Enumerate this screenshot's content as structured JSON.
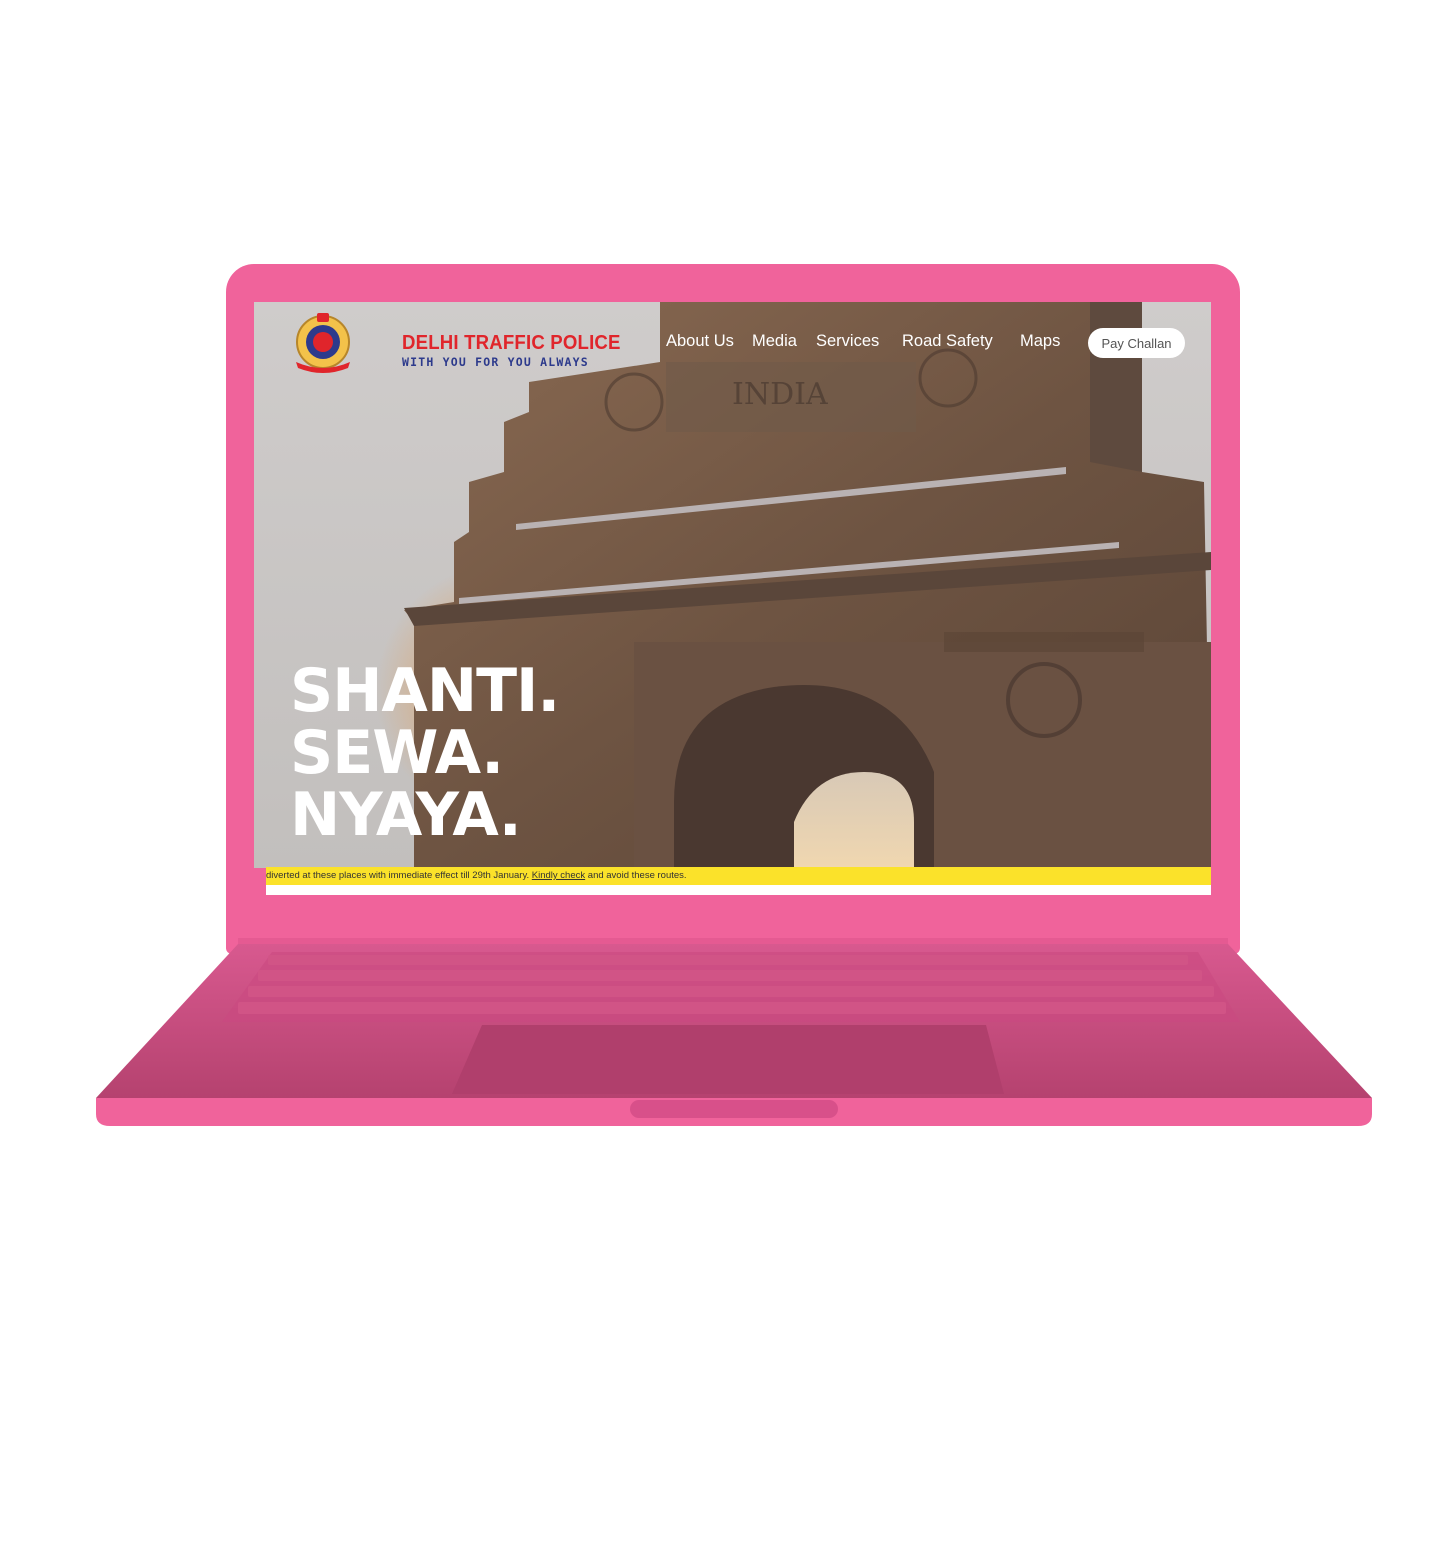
{
  "brand": {
    "title": "DELHI TRAFFIC POLICE",
    "tagline": "WITH YOU FOR YOU ALWAYS"
  },
  "nav": {
    "items": [
      {
        "label": "About Us"
      },
      {
        "label": "Media"
      },
      {
        "label": "Services"
      },
      {
        "label": "Road Safety"
      },
      {
        "label": "Maps"
      }
    ],
    "cta_label": "Pay Challan"
  },
  "hero": {
    "lines": [
      "SHANTI.",
      "SEWA.",
      "NYAYA."
    ]
  },
  "ticker": {
    "text_before": "diverted at these places with immediate effect till 29th January. ",
    "link_label": "Kindly check",
    "text_after": " and avoid these routes."
  },
  "colors": {
    "laptop": "#f0639b",
    "ticker": "#fbe22a",
    "brand_red": "#e0252b",
    "brand_blue": "#2d3a8c"
  },
  "icons": {
    "logo": "delhi-police-emblem-icon"
  }
}
